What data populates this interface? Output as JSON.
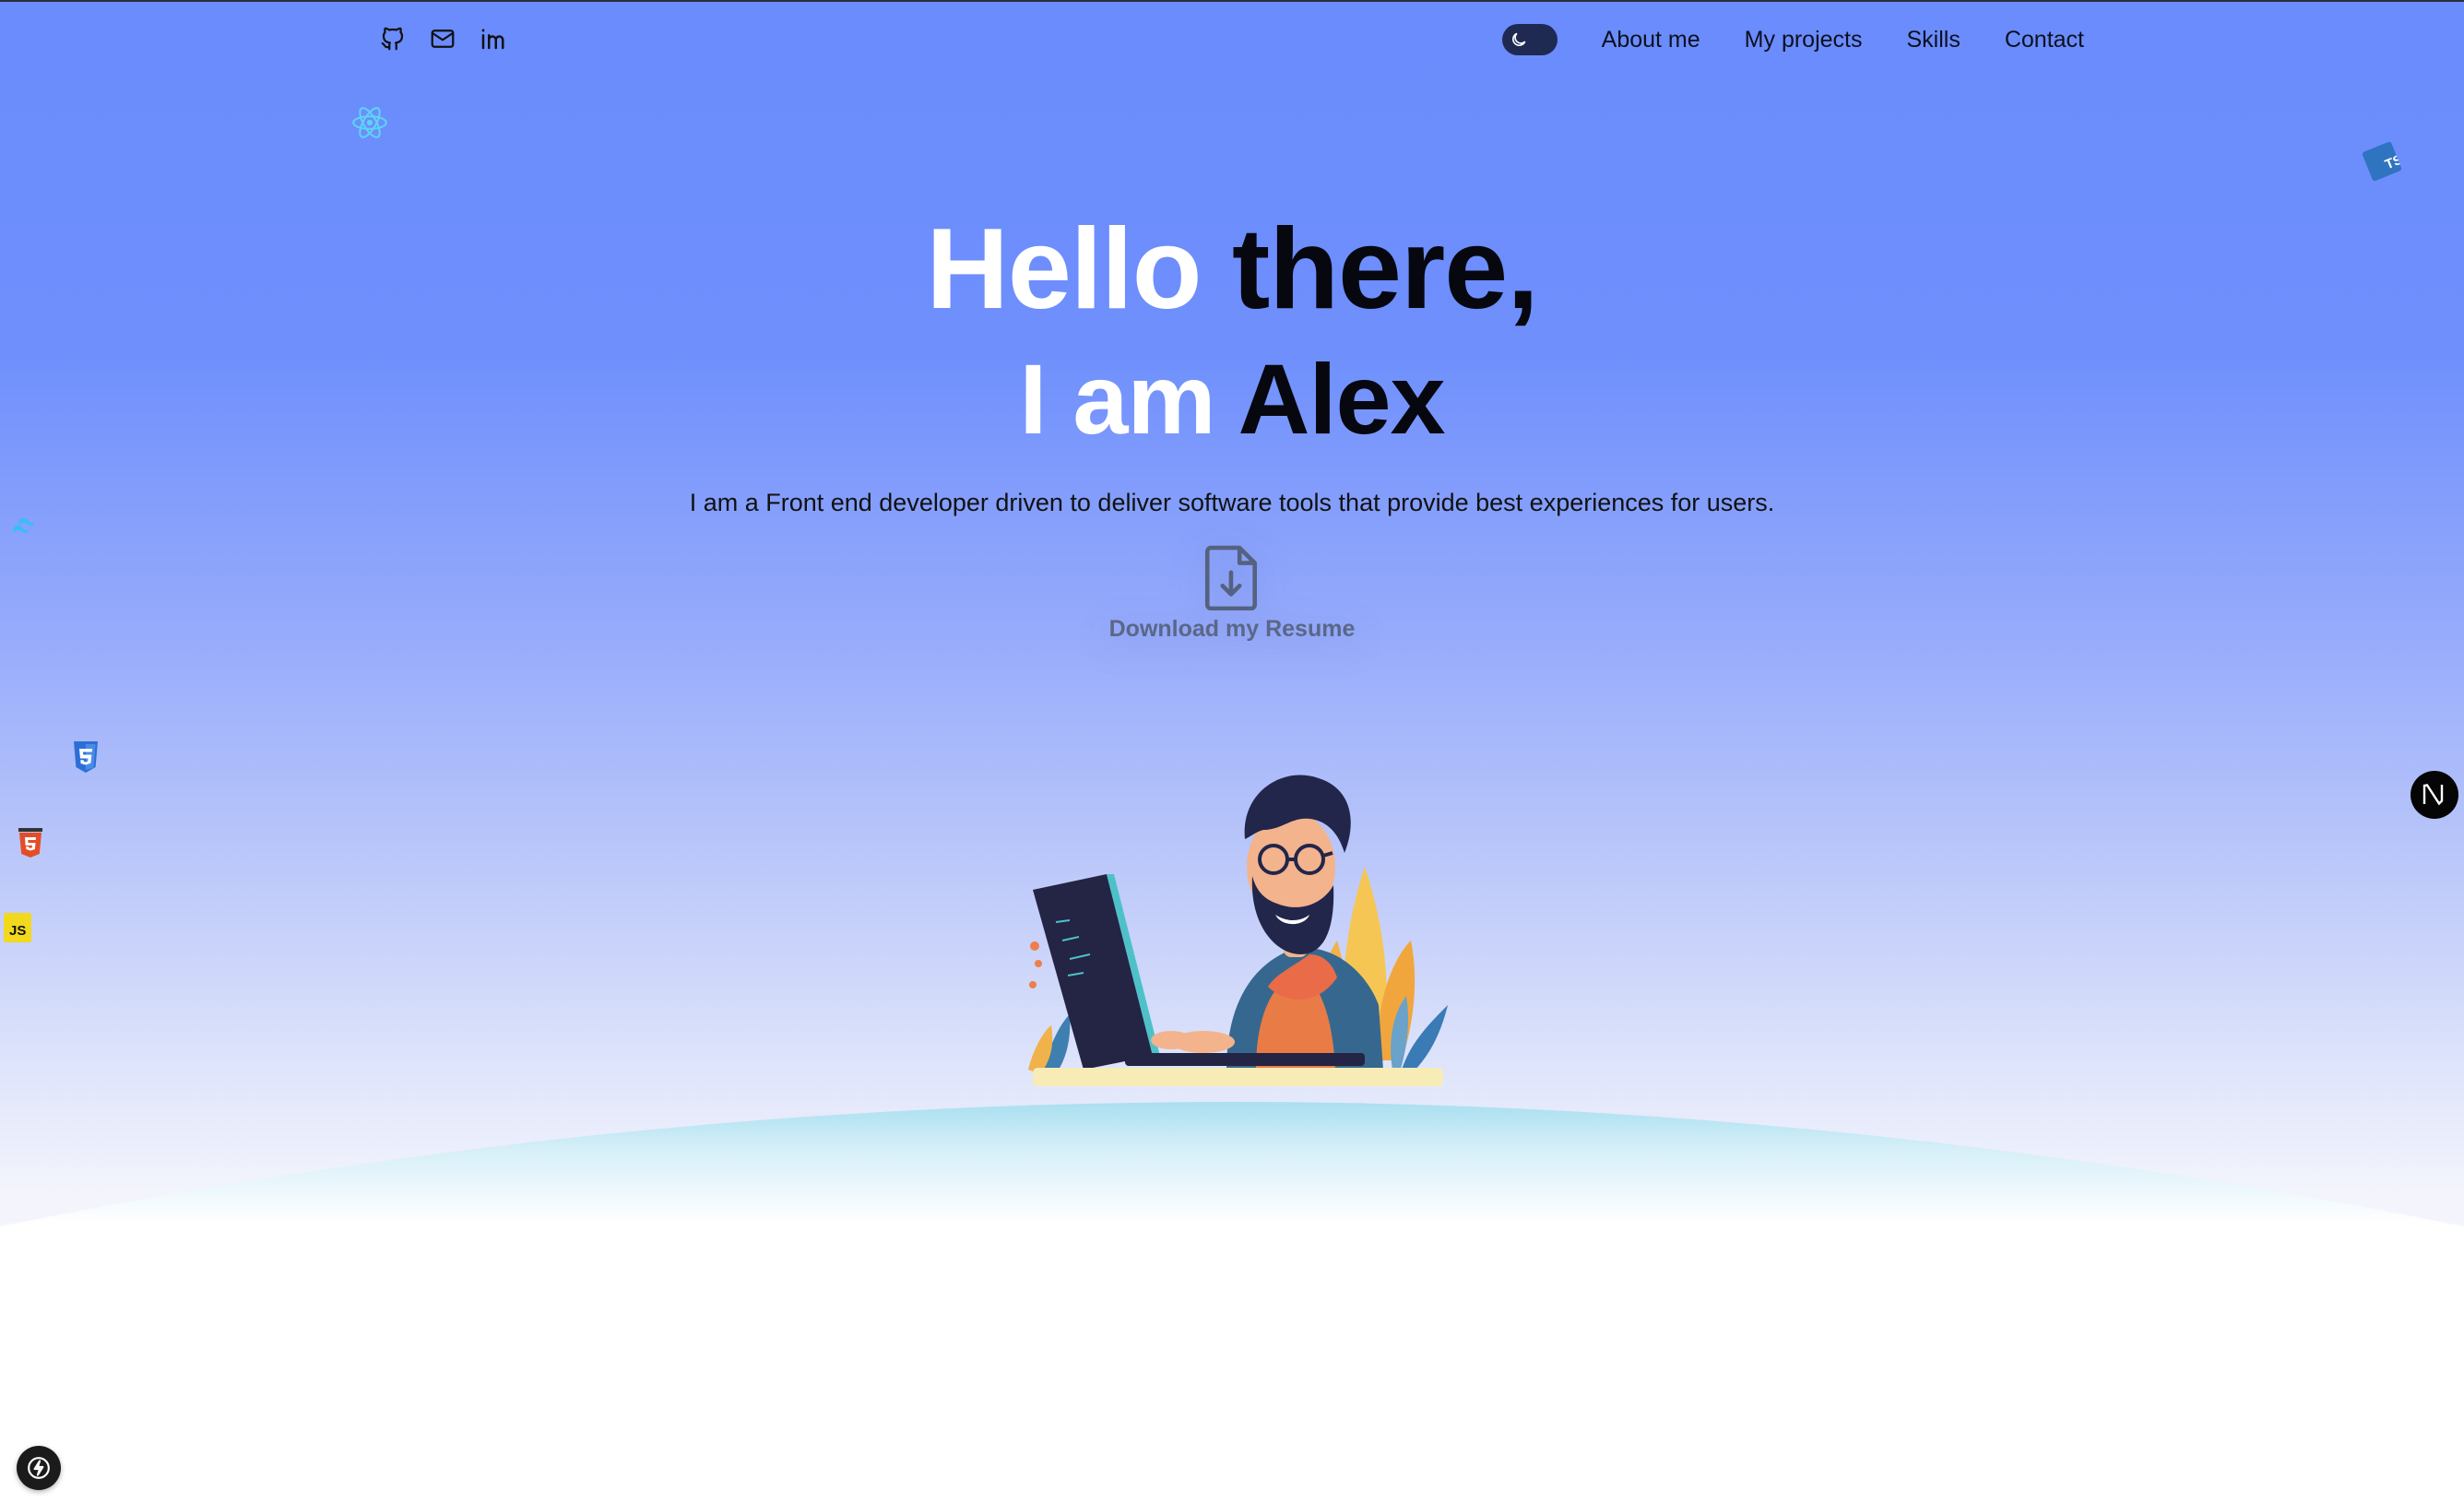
{
  "nav": {
    "social": [
      {
        "name": "github-icon",
        "label": "GitHub"
      },
      {
        "name": "mail-icon",
        "label": "Email"
      },
      {
        "name": "linkedin-icon",
        "label": "LinkedIn"
      }
    ],
    "links": [
      "About me",
      "My projects",
      "Skills",
      "Contact"
    ],
    "theme_toggle_icon": "moon-icon"
  },
  "hero": {
    "line1_white": "Hello",
    "line1_dark": "there,",
    "line2_white": "I am",
    "line2_dark": "Alex",
    "tagline": "I am a Front end developer driven to deliver software tools that provide best experiences for users.",
    "resume_label": "Download my Resume",
    "resume_icon": "file-download-icon"
  },
  "tech_icons": [
    "react-icon",
    "typescript-icon",
    "tailwind-icon",
    "css3-icon",
    "html5-icon",
    "javascript-icon",
    "nextjs-icon"
  ],
  "colors": {
    "sky_top": "#6a8cfc",
    "ground_cyan": "#a9dff0",
    "toggle_bg": "#1f2a52",
    "resume_text": "#5a6787"
  }
}
